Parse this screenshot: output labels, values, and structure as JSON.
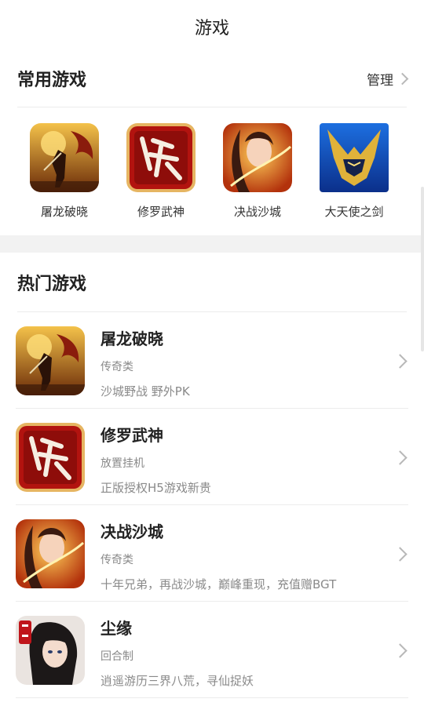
{
  "header": {
    "title": "游戏"
  },
  "favorites": {
    "title": "常用游戏",
    "manage_label": "管理",
    "items": [
      {
        "name": "屠龙破晓",
        "icon": "dragon-warrior-icon"
      },
      {
        "name": "修罗武神",
        "icon": "xiuluo-calligraphy-icon"
      },
      {
        "name": "决战沙城",
        "icon": "heroine-portrait-icon"
      },
      {
        "name": "大天使之剑",
        "icon": "golden-helmet-icon"
      }
    ]
  },
  "hot": {
    "title": "热门游戏",
    "items": [
      {
        "name": "屠龙破晓",
        "category": "传奇类",
        "desc": "沙城野战 野外PK",
        "icon": "dragon-warrior-icon"
      },
      {
        "name": "修罗武神",
        "category": "放置挂机",
        "desc": "正版授权H5游戏新贵",
        "icon": "xiuluo-calligraphy-icon"
      },
      {
        "name": "决战沙城",
        "category": "传奇类",
        "desc": "十年兄弟，再战沙城，巅峰重现，充值赠BGT",
        "icon": "heroine-portrait-icon"
      },
      {
        "name": "尘缘",
        "category": "回合制",
        "desc": "逍遥游历三界八荒，寻仙捉妖",
        "icon": "fairy-portrait-icon"
      }
    ]
  },
  "colors": {
    "background": "#ffffff",
    "band": "#f2f2f2",
    "text": "#222222",
    "muted": "#8a8a8a",
    "divider": "#ececec"
  }
}
